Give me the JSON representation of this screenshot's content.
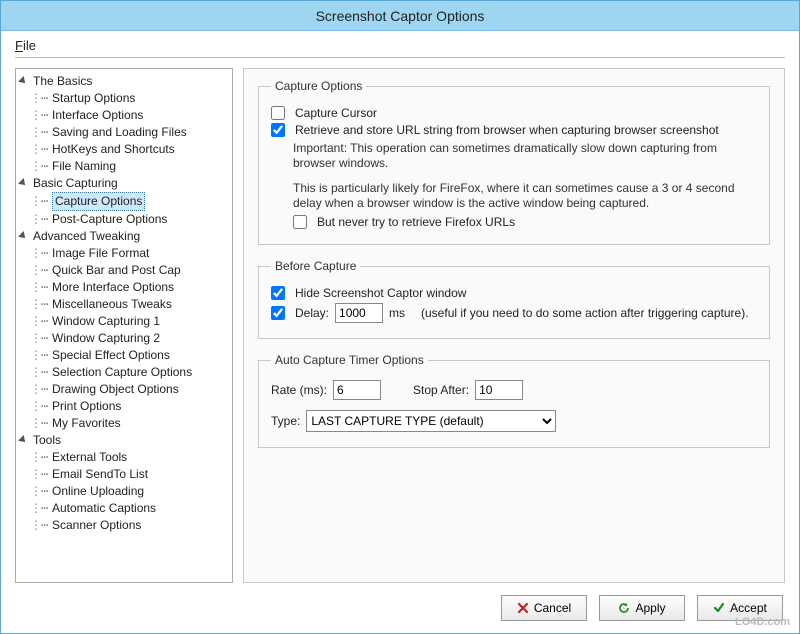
{
  "window": {
    "title": "Screenshot Captor Options"
  },
  "menubar": {
    "file": "File"
  },
  "tree": {
    "cat_basics": "The Basics",
    "basics": {
      "startup": "Startup Options",
      "interface": "Interface Options",
      "saving": "Saving and Loading Files",
      "hotkeys": "HotKeys and Shortcuts",
      "filenaming": "File Naming"
    },
    "cat_basic_capturing": "Basic Capturing",
    "basic_capturing": {
      "capture_options": "Capture Options",
      "post_capture": "Post-Capture Options"
    },
    "cat_advanced": "Advanced Tweaking",
    "advanced": {
      "image_format": "Image File Format",
      "quick_bar": "Quick Bar and Post Cap",
      "more_interface": "More Interface Options",
      "misc_tweaks": "Miscellaneous Tweaks",
      "win_cap_1": "Window Capturing 1",
      "win_cap_2": "Window Capturing 2",
      "special_fx": "Special Effect Options",
      "sel_capture": "Selection Capture Options",
      "drawing": "Drawing Object Options",
      "print": "Print Options",
      "favorites": "My Favorites"
    },
    "cat_tools": "Tools",
    "tools": {
      "external": "External Tools",
      "sendto": "Email SendTo List",
      "online": "Online Uploading",
      "captions": "Automatic Captions",
      "scanner": "Scanner Options"
    }
  },
  "content": {
    "capture_options": {
      "legend": "Capture Options",
      "capture_cursor_label": "Capture Cursor",
      "capture_cursor_checked": false,
      "retrieve_url_label": "Retrieve and store URL string from browser when capturing browser screenshot",
      "retrieve_url_checked": true,
      "note1": "Important: This operation can sometimes dramatically slow down capturing from browser windows.",
      "note2": "This is particularly likely for FireFox, where it can sometimes cause a 3  or 4 second delay when a browser window is the active window being captured.",
      "never_ff_label": "But never try to retrieve Firefox URLs",
      "never_ff_checked": false
    },
    "before_capture": {
      "legend": "Before Capture",
      "hide_label": "Hide Screenshot Captor window",
      "hide_checked": true,
      "delay_checked": true,
      "delay_label": "Delay:",
      "delay_value": "1000",
      "delay_unit": "ms",
      "delay_hint": "(useful if you need to do some action after triggering capture)."
    },
    "auto_timer": {
      "legend": "Auto Capture Timer Options",
      "rate_label": "Rate (ms):",
      "rate_value": "6",
      "stop_label": "Stop After:",
      "stop_value": "10",
      "type_label": "Type:",
      "type_value": "LAST CAPTURE TYPE (default)"
    }
  },
  "buttons": {
    "cancel": "Cancel",
    "apply": "Apply",
    "accept": "Accept"
  },
  "watermark": "LO4D.com"
}
